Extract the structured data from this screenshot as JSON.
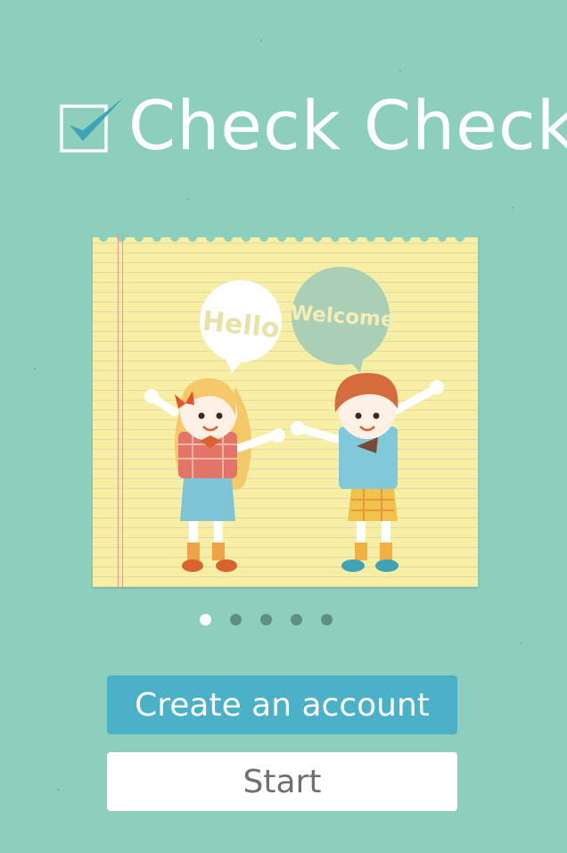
{
  "app": {
    "title": "Check Check"
  },
  "illustration": {
    "bubble_left": "Hello",
    "bubble_right": "Welcome"
  },
  "pager": {
    "count": 5,
    "active_index": 0
  },
  "actions": {
    "create_account_label": "Create an account",
    "start_label": "Start"
  },
  "colors": {
    "background": "#8ccfbc",
    "primary_button": "#4ab1c9",
    "paper": "#f7efa4"
  }
}
